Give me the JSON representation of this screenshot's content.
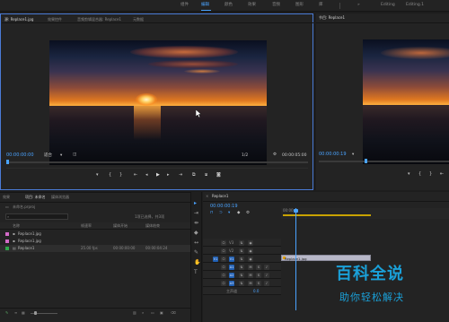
{
  "workspaces": [
    "组件",
    "编辑",
    "颜色",
    "效果",
    "音频",
    "图形",
    "库",
    "Editing",
    "Editing.1"
  ],
  "workspace_active_index": 1,
  "source": {
    "tabs": [
      "源: Replace1.jpg",
      "效果控件",
      "音频剪辑混合器: Replace1",
      "元数据"
    ],
    "active_tab": 0,
    "timecode_in": "00:00:00:00",
    "zoom": "适合",
    "resolution": "1/2",
    "timecode_out": "00:00:05:00",
    "playhead_fraction": 0.0
  },
  "program": {
    "tab": "节目: Replace1",
    "timecode": "00:00:00:19"
  },
  "project": {
    "tabs": [
      "项目: 未命名",
      "媒体浏览器"
    ],
    "title": "未命名.prproj",
    "selection_info": "1项已选择，共3项",
    "columns": [
      "名称",
      "帧速率",
      "媒体开始",
      "媒体结束"
    ],
    "items": [
      {
        "name": "Replace1.jpg",
        "color": "#d36ac8",
        "fps": "",
        "start": "",
        "end": ""
      },
      {
        "name": "Replace1.jpg",
        "color": "#d36ac8",
        "fps": "",
        "start": "",
        "end": ""
      },
      {
        "name": "Replace1",
        "color": "#2ea84a",
        "fps": "25.00 fps",
        "start": "00:00:00:00",
        "end": "00:00:04:24"
      }
    ]
  },
  "timeline": {
    "tab": "Replace1",
    "timecode": "00:00:00:19",
    "ruler_start": "00:00",
    "tracks": [
      {
        "label": "V3",
        "type": "video"
      },
      {
        "label": "V2",
        "type": "video"
      },
      {
        "label": "V1",
        "type": "video"
      },
      {
        "label": "A1",
        "type": "audio"
      },
      {
        "label": "A2",
        "type": "audio"
      },
      {
        "label": "A3",
        "type": "audio"
      }
    ],
    "master": "主声道",
    "master_value": "0.0",
    "clip_label": "Replace1.jpg"
  },
  "watermark": {
    "title": "百科全说",
    "subtitle": "助你轻松解决"
  },
  "colors": {
    "accent": "#4aa3ff",
    "workarea": "#c8a200",
    "watermark": "#1aa0d8"
  }
}
